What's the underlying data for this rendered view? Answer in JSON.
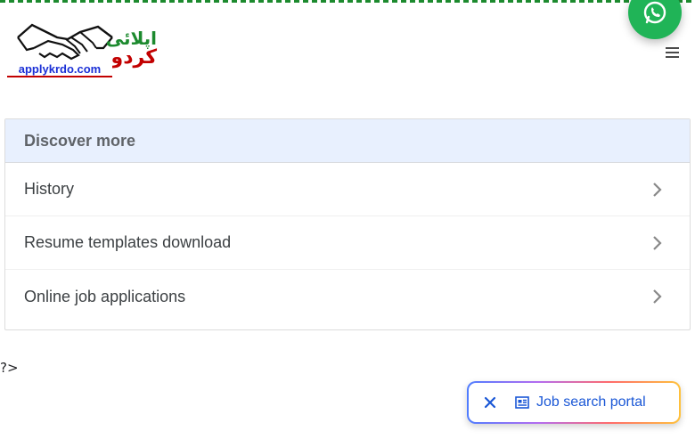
{
  "logo": {
    "domain_text": "applykrdo.com",
    "urdu_line1": "اپلائی",
    "urdu_line2": "کردو"
  },
  "discover": {
    "title": "Discover more",
    "items": [
      {
        "label": "History"
      },
      {
        "label": "Resume templates download"
      },
      {
        "label": "Online job applications"
      }
    ]
  },
  "stray_text": "?>",
  "floating_bar": {
    "link_label": "Job search portal"
  },
  "colors": {
    "whatsapp": "#20b457",
    "header_bg": "#e8f0fe",
    "link": "#1a57d6",
    "border_dots": "#1c8a2e"
  }
}
